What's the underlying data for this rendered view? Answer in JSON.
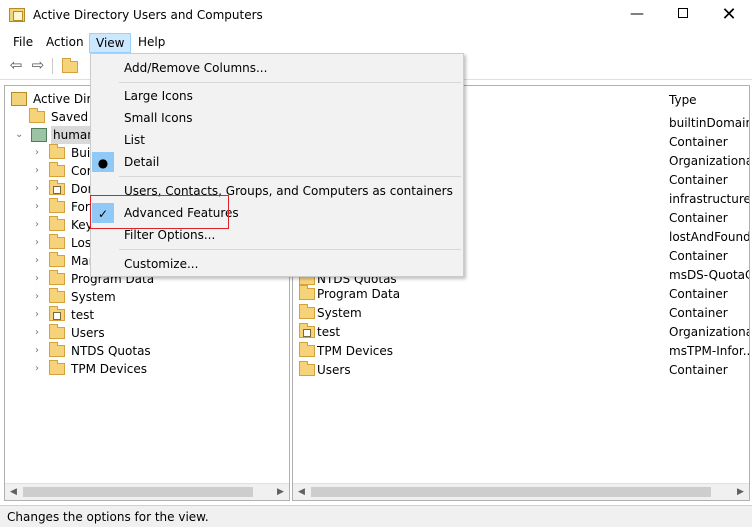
{
  "window": {
    "title": "Active Directory Users and Computers",
    "controls": {
      "minimize": "—",
      "close": "✕"
    }
  },
  "menubar": {
    "file": "File",
    "action": "Action",
    "view": "View",
    "help": "Help"
  },
  "toolbar": {
    "back": "⇦",
    "forward": "⇨",
    "up": "up-folder-icon"
  },
  "tree": {
    "root": "Active Directo",
    "saved": "Saved C",
    "domain": "human",
    "items": [
      "Buil",
      "Com",
      "Dor",
      "Fore",
      "Key",
      "Lost",
      "Mar",
      "Program Data",
      "System",
      "test",
      "Users",
      "NTDS Quotas",
      "TPM Devices"
    ]
  },
  "list": {
    "type_header": "Type",
    "partial_name": "NTDS Quotas",
    "names": [
      "Program Data",
      "System",
      "test",
      "TPM Devices",
      "Users"
    ],
    "types": [
      "builtinDomain",
      "Container",
      "Organizational...",
      "Container",
      "infrastructureU...",
      "Container",
      "lostAndFound",
      "Container",
      "msDS-QuotaC...",
      "Container",
      "Container",
      "Organizational...",
      "msTPM-Infor...",
      "Container"
    ]
  },
  "view_menu": {
    "add_remove": "Add/Remove Columns...",
    "large_icons": "Large Icons",
    "small_icons": "Small Icons",
    "list": "List",
    "detail": "Detail",
    "containers": "Users, Contacts, Groups, and Computers as containers",
    "advanced": "Advanced Features",
    "filter": "Filter Options...",
    "customize": "Customize...",
    "selected_view": "Detail",
    "advanced_checked": true,
    "accent_color": "#90c8f6",
    "highlight_color": "#d9242a"
  },
  "status": {
    "text": "Changes the options for the view."
  }
}
